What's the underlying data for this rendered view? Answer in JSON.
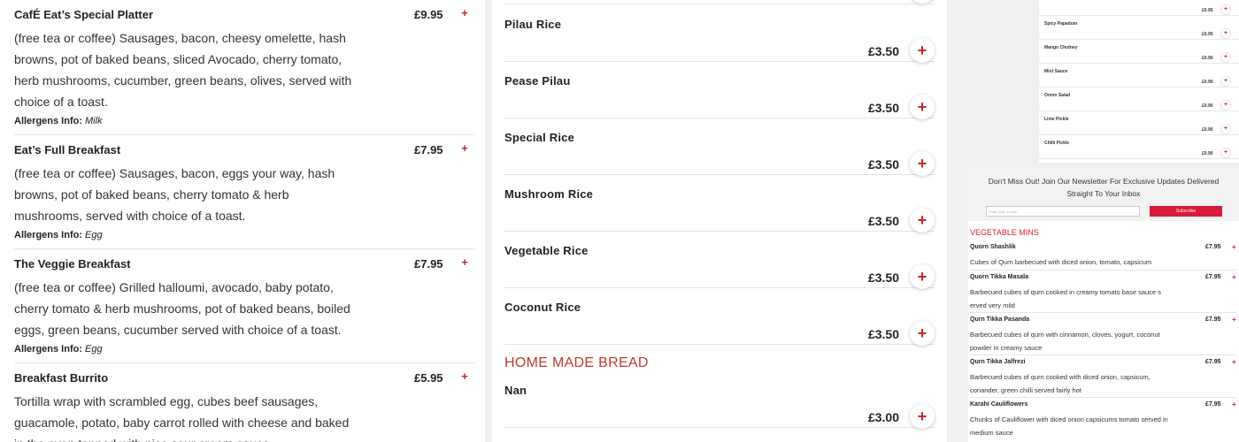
{
  "breakfast": {
    "items": [
      {
        "name": "CafÉ Eat’s Special Platter",
        "price": "£9.95",
        "desc": "(free tea or coffee) Sausages, bacon, cheesy omelette, hash browns, pot of baked beans, sliced Avocado, cherry tomato, herb mushrooms, cucumber, green beans, olives, served with choice of a toast.",
        "allergen_label": "Allergens Info:",
        "allergen": "Milk"
      },
      {
        "name": "Eat’s Full Breakfast",
        "price": "£7.95",
        "desc": "(free tea or coffee) Sausages, bacon, eggs your way, hash browns, pot of baked beans, cherry tomato & herb mushrooms, served with choice of a toast.",
        "allergen_label": "Allergens Info:",
        "allergen": "Egg"
      },
      {
        "name": "The Veggie Breakfast",
        "price": "£7.95",
        "desc": "(free tea or coffee) Grilled halloumi, avocado, baby potato, cherry tomato & herb mushrooms, pot of baked beans, boiled eggs, green beans, cucumber served with choice of a toast.",
        "allergen_label": "Allergens Info:",
        "allergen": "Egg"
      },
      {
        "name": "Breakfast Burrito",
        "price": "£5.95",
        "desc": "Tortilla wrap with scrambled egg, cubes beef sausages, guacamole, potato, baby carrot rolled with cheese and baked in the oven topped with nice sour cream sauce.",
        "allergen_label": "",
        "allergen": ""
      }
    ],
    "add_symbol": "+"
  },
  "rice": {
    "items": [
      {
        "name": "Pilau Rice",
        "price": "£3.50"
      },
      {
        "name": "Pease Pilau",
        "price": "£3.50"
      },
      {
        "name": "Special Rice",
        "price": "£3.50"
      },
      {
        "name": "Mushroom Rice",
        "price": "£3.50"
      },
      {
        "name": "Vegetable Rice",
        "price": "£3.50"
      },
      {
        "name": "Coconut Rice",
        "price": "£3.50"
      }
    ],
    "bread_heading": "HOME MADE BREAD",
    "bread_items": [
      {
        "name": "Nan",
        "price": "£3.00"
      }
    ],
    "add_symbol": "+"
  },
  "sides": {
    "items": [
      {
        "name": "Spicy Papadum",
        "price": "£0.95"
      },
      {
        "name": "Mango Chutney",
        "price": "£0.90"
      },
      {
        "name": "Mint Sauce",
        "price": "£0.90"
      },
      {
        "name": "Onion Salad",
        "price": "£0.90"
      },
      {
        "name": "Lime Pickle",
        "price": "£0.90"
      },
      {
        "name": "Chilli Pickle",
        "price": "£0.90"
      }
    ],
    "top_price": "£0.95",
    "add_symbol": "+"
  },
  "newsletter": {
    "text": "Don't Miss Out! Join Our Newsletter For Exclusive Updates Delivered Straight To Your Inbox",
    "placeholder": "Enter your e-mail",
    "button": "Subscribe"
  },
  "veg": {
    "title": "VEGETABLE MINS",
    "items": [
      {
        "name": "Quorn Shashlik",
        "price": "£7.95",
        "desc": "Cubes of Qurn barbecued with diced onion, tomato, capsicum"
      },
      {
        "name": "Quorn Tikka Masala",
        "price": "£7.95",
        "desc": "Barbecued cubes of qurn cooked in creamy tomato base sauce s erved very mild"
      },
      {
        "name": "Qurn Tikka Pasanda",
        "price": "£7.95",
        "desc": "Barbecued cubes of qurn with cinnamon, cloves, yogurt, coconut powder in creamy sauce"
      },
      {
        "name": "Qurn Tikka Jalfrezi",
        "price": "£7.95",
        "desc": "Barbecued cubes of qurn cooked with diced onion, capsicum, coriander, green chilli served fairly hot"
      },
      {
        "name": "Karahi Cauliflowers",
        "price": "£7.95",
        "desc": "Chunks of Cauliflower with diced onion capsicums tomato served in medium sauce"
      }
    ],
    "add_symbol": "+"
  }
}
